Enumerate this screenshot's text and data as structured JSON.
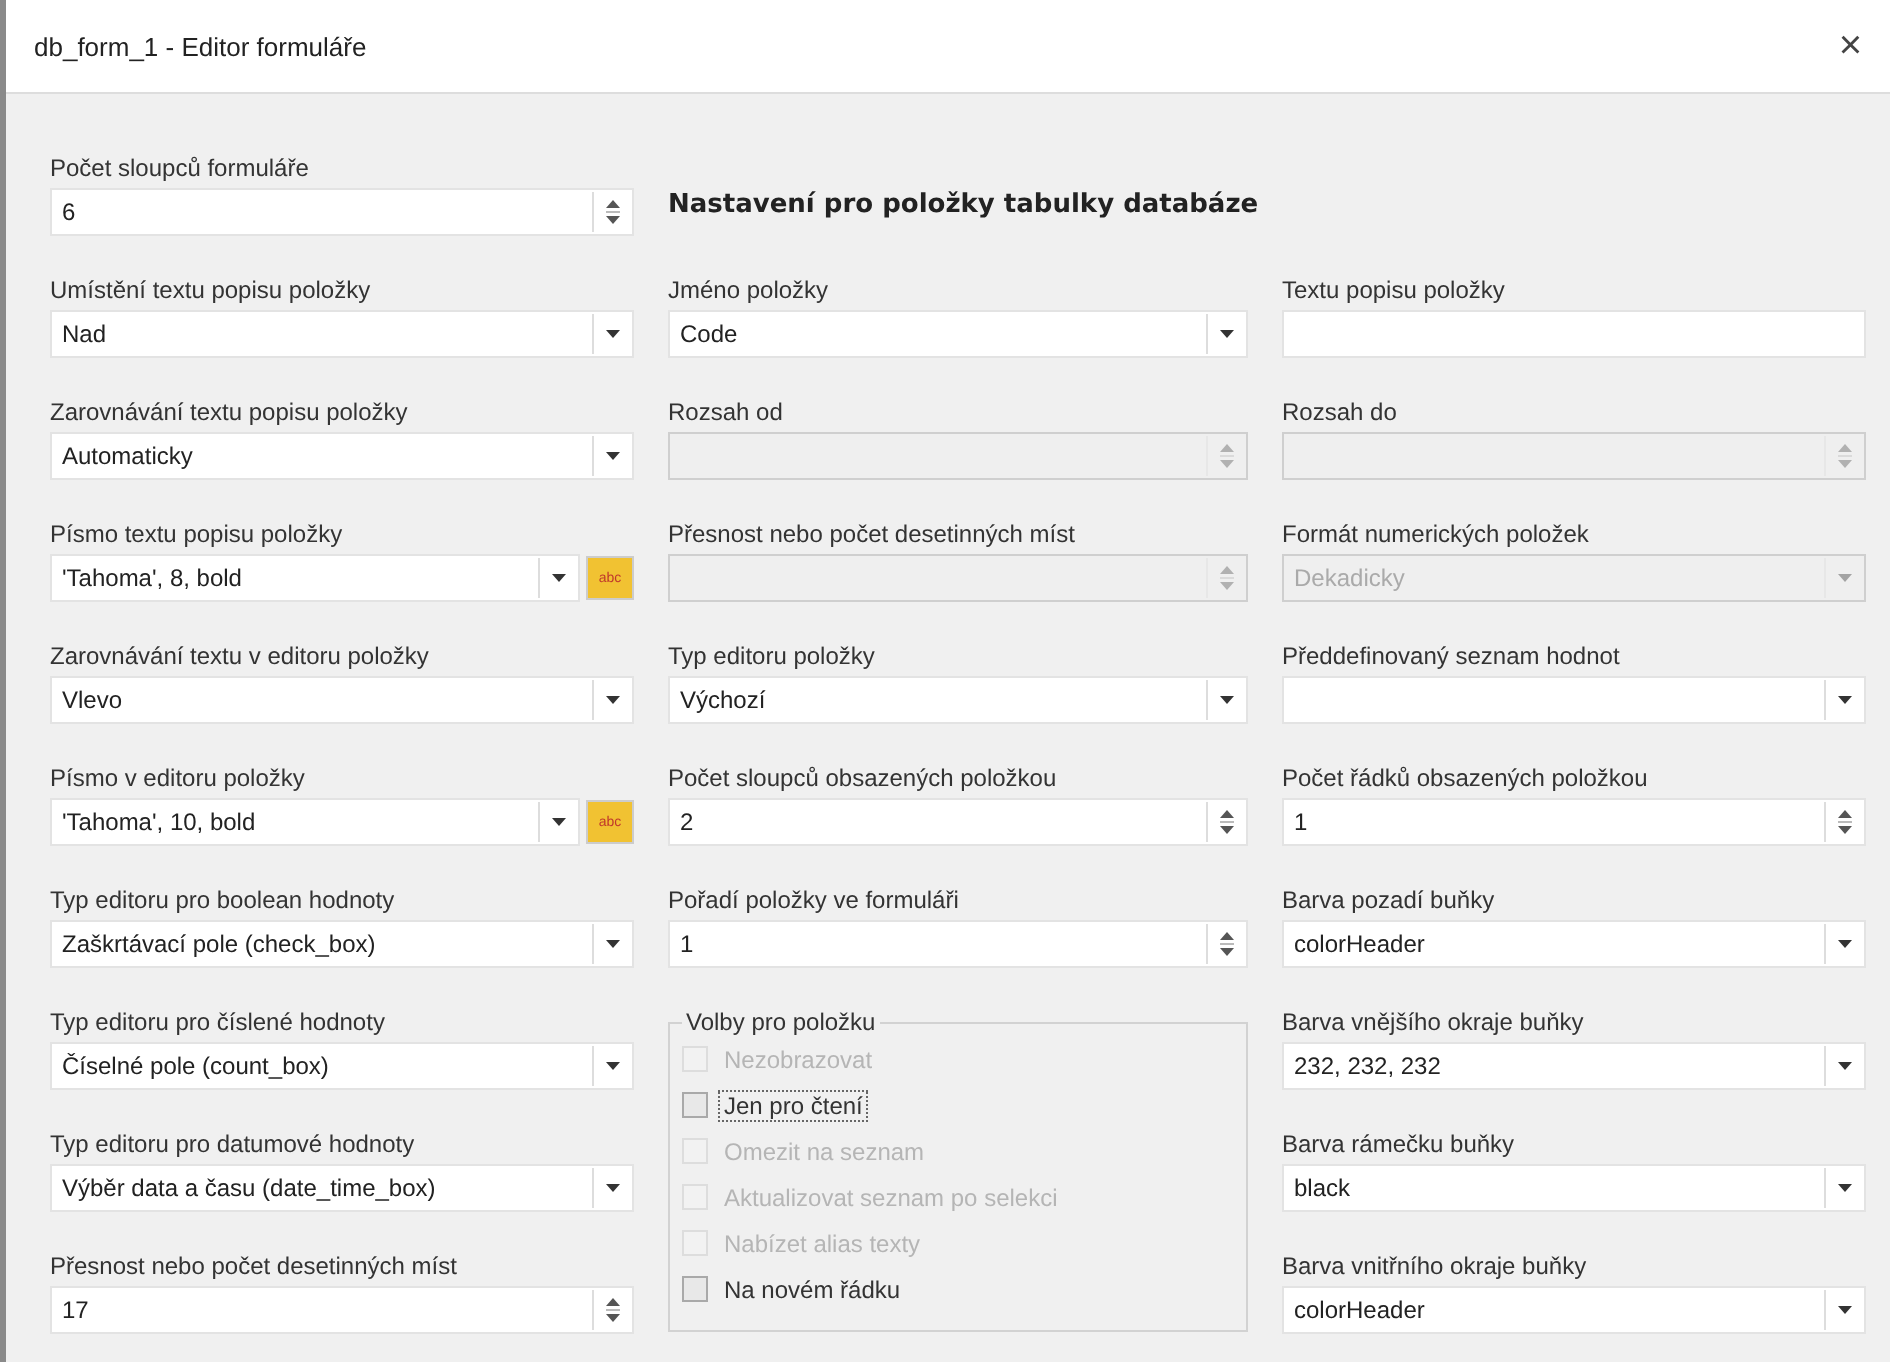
{
  "window": {
    "title": "db_form_1 - Editor formuláře",
    "close": "×"
  },
  "columns": [
    {
      "items": [
        {
          "kind": "spin",
          "label": "Počet sloupců formuláře",
          "value": "6",
          "disabled": false
        },
        {
          "kind": "combo",
          "label": "Umístění textu popisu položky",
          "value": "Nad",
          "disabled": false
        },
        {
          "kind": "combo",
          "label": "Zarovnávání textu popisu položky",
          "value": "Automaticky",
          "disabled": false
        },
        {
          "kind": "font",
          "label": "Písmo textu popisu položky",
          "value": "'Tahoma', 8, bold",
          "button": "abc",
          "disabled": false
        },
        {
          "kind": "combo",
          "label": "Zarovnávání textu v editoru položky",
          "value": "Vlevo",
          "disabled": false
        },
        {
          "kind": "font",
          "label": "Písmo v editoru položky",
          "value": "'Tahoma', 10, bold",
          "button": "abc",
          "disabled": false
        },
        {
          "kind": "combo",
          "label": "Typ editoru pro boolean hodnoty",
          "value": "Zaškrtávací pole (check_box)",
          "disabled": false
        },
        {
          "kind": "combo",
          "label": "Typ editoru pro číslené hodnoty",
          "value": "Číselné pole (count_box)",
          "disabled": false
        },
        {
          "kind": "combo",
          "label": "Typ editoru pro datumové hodnoty",
          "value": "Výběr data a času (date_time_box)",
          "disabled": false
        },
        {
          "kind": "spin",
          "label": "Přesnost nebo počet desetinných míst",
          "value": "17",
          "disabled": false
        }
      ]
    },
    {
      "items": [
        {
          "kind": "heading",
          "label": "Nastavení pro položky tabulky databáze"
        },
        {
          "kind": "combo",
          "label": "Jméno položky",
          "value": "Code",
          "disabled": false
        },
        {
          "kind": "spin",
          "label": "Rozsah od",
          "disabled": true
        },
        {
          "kind": "spin",
          "label": "Přesnost nebo počet desetinných míst",
          "disabled": true
        },
        {
          "kind": "combo",
          "label": "Typ editoru položky",
          "value": "Výchozí",
          "disabled": false
        },
        {
          "kind": "spin",
          "label": "Počet sloupců obsazených položkou",
          "value": "2",
          "disabled": false
        },
        {
          "kind": "spin",
          "label": "Pořadí položky ve formuláři",
          "value": "1",
          "disabled": false
        },
        {
          "kind": "group",
          "label": "Volby pro položku",
          "options": [
            {
              "label": "Nezobrazovat",
              "checked": false,
              "disabled": true,
              "focused": false
            },
            {
              "label": "Jen pro čtení",
              "checked": false,
              "disabled": false,
              "focused": true
            },
            {
              "label": "Omezit na seznam",
              "checked": false,
              "disabled": true,
              "focused": false
            },
            {
              "label": "Aktualizovat seznam po selekci",
              "checked": false,
              "disabled": true,
              "focused": false
            },
            {
              "label": "Nabízet alias texty",
              "checked": false,
              "disabled": true,
              "focused": false
            },
            {
              "label": "Na novém řádku",
              "checked": false,
              "disabled": false,
              "focused": false
            }
          ]
        }
      ]
    },
    {
      "items": [
        {
          "kind": "empty"
        },
        {
          "kind": "text",
          "label": "Textu popisu položky",
          "disabled": false
        },
        {
          "kind": "spin",
          "label": "Rozsah do",
          "disabled": true
        },
        {
          "kind": "combo",
          "label": "Formát numerických položek",
          "value": "Dekadicky",
          "disabled": true
        },
        {
          "kind": "combo",
          "label": "Předdefinovaný seznam hodnot",
          "disabled": false
        },
        {
          "kind": "spin",
          "label": "Počet řádků obsazených položkou",
          "value": "1",
          "disabled": false
        },
        {
          "kind": "combo",
          "label": "Barva pozadí buňky",
          "value": "colorHeader",
          "disabled": false
        },
        {
          "kind": "combo",
          "label": "Barva vnějšího okraje buňky",
          "value": "232, 232, 232",
          "disabled": false
        },
        {
          "kind": "combo",
          "label": "Barva rámečku buňky",
          "value": "black",
          "disabled": false
        },
        {
          "kind": "combo",
          "label": "Barva vnitřního okraje buňky",
          "value": "colorHeader",
          "disabled": false
        }
      ]
    }
  ]
}
